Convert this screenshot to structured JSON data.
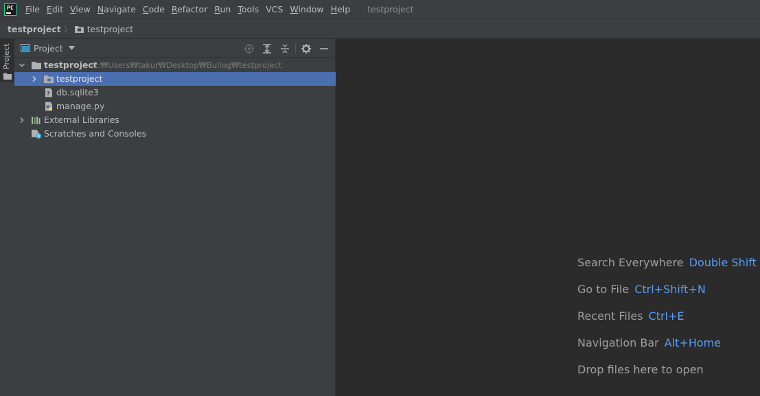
{
  "app": {
    "logo_text": "PC",
    "window_title": "testproject"
  },
  "menu": [
    {
      "mnemonic": "F",
      "rest": "ile"
    },
    {
      "mnemonic": "E",
      "rest": "dit"
    },
    {
      "mnemonic": "V",
      "rest": "iew"
    },
    {
      "mnemonic": "N",
      "rest": "avigate"
    },
    {
      "mnemonic": "C",
      "rest": "ode"
    },
    {
      "mnemonic": "R",
      "rest": "efactor"
    },
    {
      "mnemonic": "R",
      "rest": "un"
    },
    {
      "mnemonic": "T",
      "rest": "ools"
    },
    {
      "mnemonic": "",
      "rest": "VCS"
    },
    {
      "mnemonic": "W",
      "rest": "indow"
    },
    {
      "mnemonic": "H",
      "rest": "elp"
    }
  ],
  "breadcrumb": {
    "root": "testproject",
    "separator": "〉",
    "child": "testproject"
  },
  "stripe": {
    "tab_label": "Project"
  },
  "project_panel": {
    "title": "Project",
    "tree": {
      "root": {
        "label": "testproject",
        "path": "C:₩Users₩takur₩Desktop₩Bullog₩testproject"
      },
      "children": [
        {
          "label": "testproject"
        },
        {
          "label": "db.sqlite3"
        },
        {
          "label": "manage.py"
        }
      ],
      "external_libraries": "External Libraries",
      "scratches": "Scratches and Consoles"
    }
  },
  "editor_hints": [
    {
      "text": "Search Everywhere",
      "shortcut": "Double Shift"
    },
    {
      "text": "Go to File",
      "shortcut": "Ctrl+Shift+N"
    },
    {
      "text": "Recent Files",
      "shortcut": "Ctrl+E"
    },
    {
      "text": "Navigation Bar",
      "shortcut": "Alt+Home"
    },
    {
      "text": "Drop files here to open",
      "shortcut": ""
    }
  ],
  "colors": {
    "panel_bg": "#3c3f41",
    "editor_bg": "#2b2b2b",
    "selection": "#4b6eaf",
    "shortcut_accent": "#589df6",
    "hint_text": "#a0a0a0"
  }
}
